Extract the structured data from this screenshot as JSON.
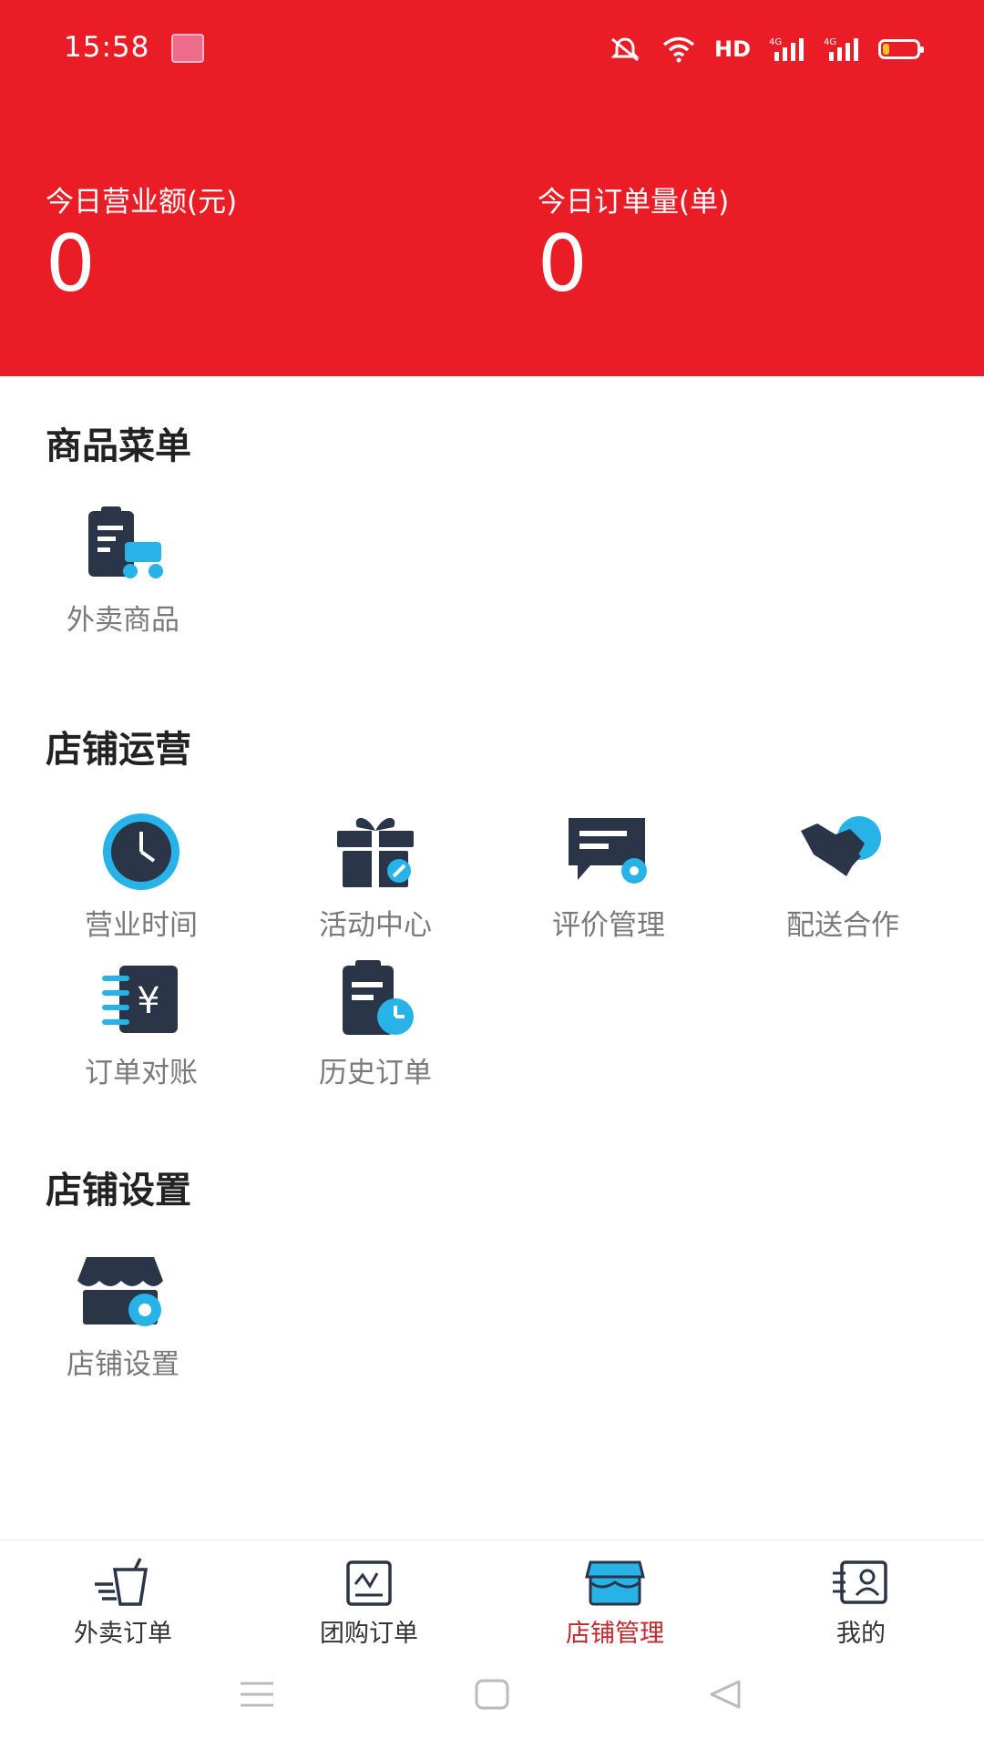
{
  "status_bar": {
    "time": "15:58",
    "network": "HD",
    "signal_1": "4G",
    "signal_2": "4G",
    "battery_level": 0.2
  },
  "stats": [
    {
      "label": "今日营业额(元)",
      "value": "0"
    },
    {
      "label": "今日订单量(单)",
      "value": "0"
    }
  ],
  "sections": {
    "goods": {
      "title": "商品菜单",
      "items": [
        {
          "label": "外卖商品",
          "icon": "takeaway-goods-icon"
        }
      ]
    },
    "operations": {
      "title": "店铺运营",
      "items": [
        {
          "label": "营业时间",
          "icon": "clock-icon"
        },
        {
          "label": "活动中心",
          "icon": "gift-icon"
        },
        {
          "label": "评价管理",
          "icon": "review-icon"
        },
        {
          "label": "配送合作",
          "icon": "handshake-icon"
        },
        {
          "label": "订单对账",
          "icon": "yuan-ledger-icon"
        },
        {
          "label": "历史订单",
          "icon": "history-order-icon"
        }
      ]
    },
    "settings": {
      "title": "店铺设置",
      "items": [
        {
          "label": "店铺设置",
          "icon": "store-gear-icon"
        }
      ]
    }
  },
  "tabs": [
    {
      "label": "外卖订单",
      "icon": "takeaway-cup-icon"
    },
    {
      "label": "团购订单",
      "icon": "group-order-icon"
    },
    {
      "label": "店铺管理",
      "icon": "store-icon",
      "active": true
    },
    {
      "label": "我的",
      "icon": "profile-card-icon"
    }
  ],
  "colors": {
    "brand_red": "#ea1c26",
    "icon_navy": "#2a3547",
    "icon_cyan": "#27b2e8",
    "active_tab": "#c1272d"
  }
}
